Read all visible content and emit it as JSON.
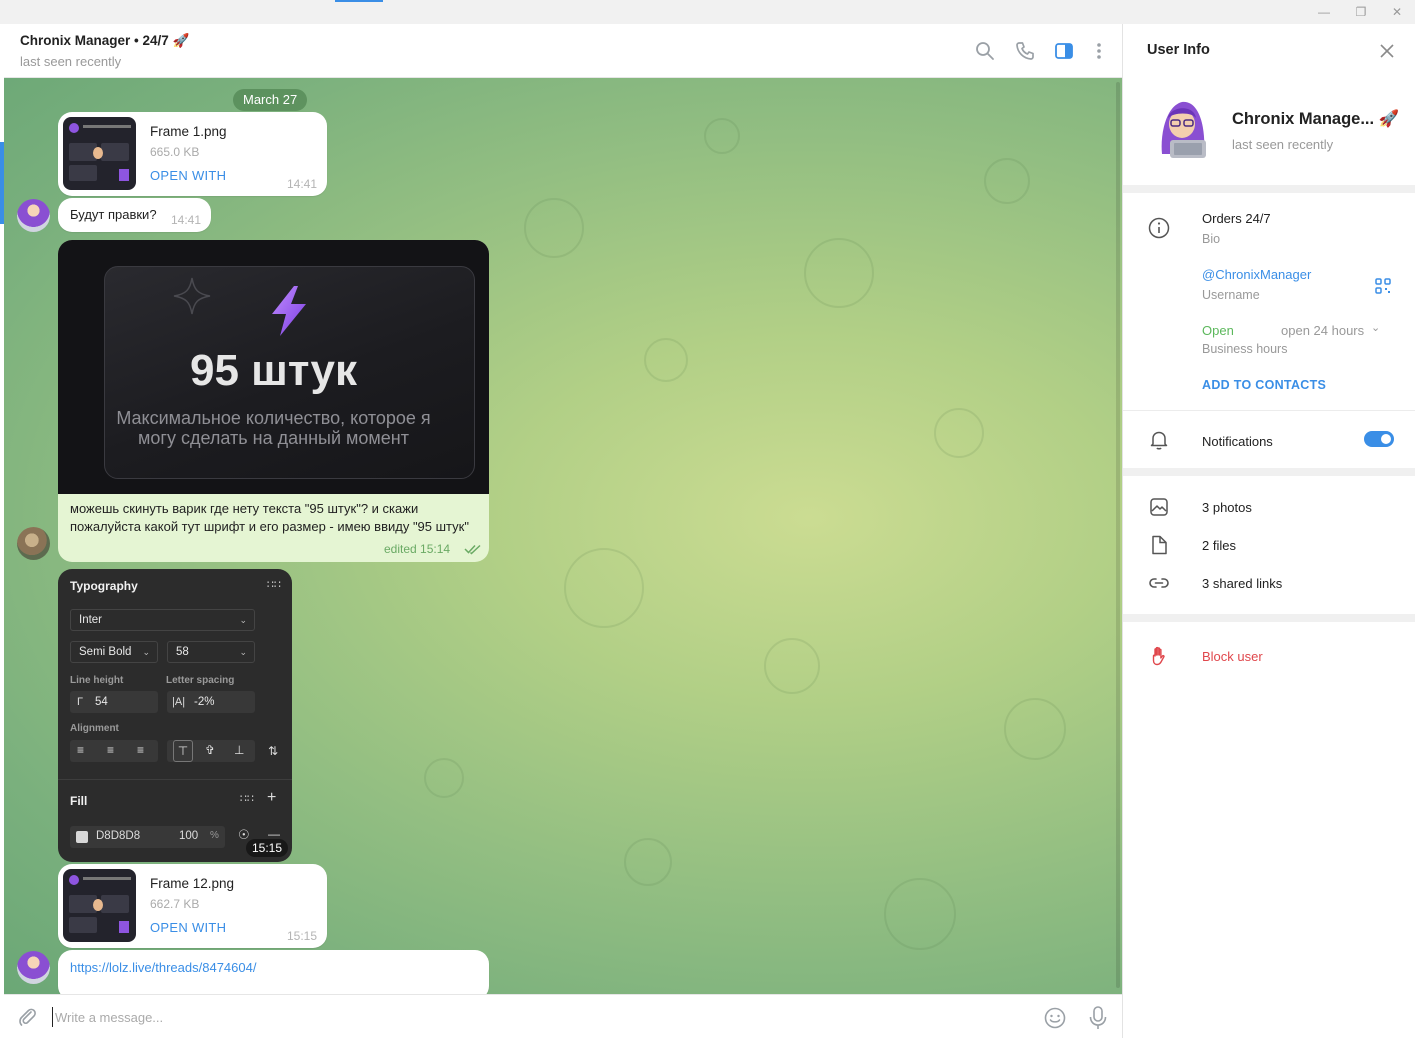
{
  "chat_header": {
    "title": "Chronix Manager • 24/7 🚀",
    "status": "last seen recently"
  },
  "chat": {
    "date_label": "March 27",
    "messages": [
      {
        "type": "file",
        "name": "Frame 1.png",
        "size": "665.0 KB",
        "action": "OPEN WITH",
        "time": "14:41"
      },
      {
        "type": "text",
        "text": "Будут правки?",
        "time": "14:41"
      },
      {
        "type": "image",
        "image_heading": "95 штук",
        "image_sub_line1": "Максимальное количество, которое я",
        "image_sub_line2": "могу сделать на данный момент",
        "caption": "можешь скинуть варик где нету текста \"95 штук\"? и скажи пожалуйста какой тут шрифт и его размер - имею ввиду \"95 штук\"",
        "time": "edited 15:14"
      },
      {
        "type": "typography",
        "title": "Typography",
        "font": "Inter",
        "weight": "Semi Bold",
        "size": "58",
        "line_height_label": "Line height",
        "line_height": "54",
        "letter_spacing_label": "Letter spacing",
        "letter_spacing": "-2%",
        "alignment_label": "Alignment",
        "fill_label": "Fill",
        "fill_color": "D8D8D8",
        "fill_opacity": "100",
        "fill_unit": "%",
        "time": "15:15"
      },
      {
        "type": "file",
        "name": "Frame 12.png",
        "size": "662.7 KB",
        "action": "OPEN WITH",
        "time": "15:15"
      },
      {
        "type": "link",
        "text": "https://lolz.live/threads/8474604/"
      }
    ]
  },
  "composer": {
    "placeholder": "Write a message..."
  },
  "user_info": {
    "title": "User Info",
    "name": "Chronix Manage... 🚀",
    "status": "last seen recently",
    "bio": "Orders 24/7",
    "bio_label": "Bio",
    "username": "@ChronixManager",
    "username_label": "Username",
    "hours_status": "Open",
    "hours_value": "open 24 hours",
    "hours_label": "Business hours",
    "add_contacts": "ADD TO CONTACTS",
    "notifications": "Notifications",
    "notifications_on": true,
    "photos": "3 photos",
    "files": "2 files",
    "links": "3 shared links",
    "block": "Block user"
  },
  "colors": {
    "accent": "#3a8ee6",
    "online": "#5cb85c",
    "danger": "#e0474c"
  }
}
